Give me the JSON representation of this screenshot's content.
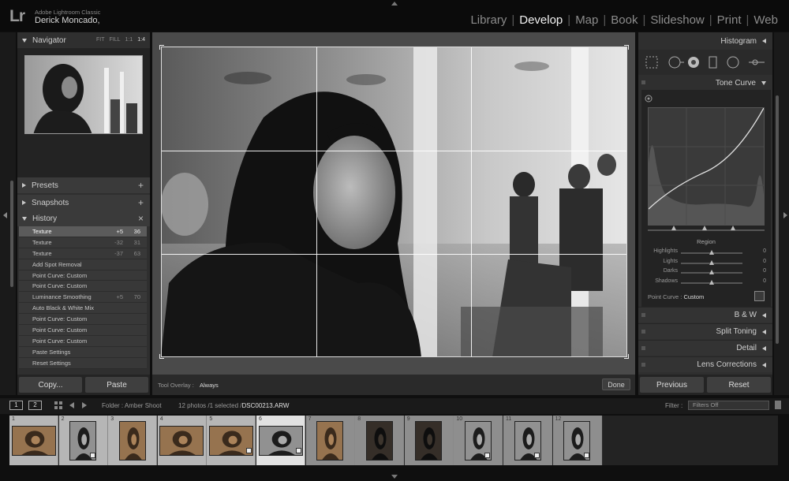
{
  "app": {
    "logo": "Lr",
    "app_name": "Adobe Lightroom Classic",
    "user_name": "Derick Moncado,"
  },
  "modules": [
    {
      "label": "Library",
      "active": false
    },
    {
      "label": "Develop",
      "active": true
    },
    {
      "label": "Map",
      "active": false
    },
    {
      "label": "Book",
      "active": false
    },
    {
      "label": "Slideshow",
      "active": false
    },
    {
      "label": "Print",
      "active": false
    },
    {
      "label": "Web",
      "active": false
    }
  ],
  "navigator": {
    "title": "Navigator",
    "zoom_fit": "FIT",
    "zoom_fill": "FILL",
    "zoom_1_1": "1:1",
    "zoom_1_4": "1:4"
  },
  "presets": {
    "title": "Presets"
  },
  "snapshots": {
    "title": "Snapshots"
  },
  "history": {
    "title": "History",
    "close": "×",
    "items": [
      {
        "label": "Texture",
        "v1": "+5",
        "v2": "36",
        "selected": true
      },
      {
        "label": "Texture",
        "v1": "-32",
        "v2": "31",
        "selected": false
      },
      {
        "label": "Texture",
        "v1": "-37",
        "v2": "63",
        "selected": false
      },
      {
        "label": "Add Spot Removal",
        "v1": "",
        "v2": "",
        "selected": false
      },
      {
        "label": "Point Curve: Custom",
        "v1": "",
        "v2": "",
        "selected": false
      },
      {
        "label": "Point Curve: Custom",
        "v1": "",
        "v2": "",
        "selected": false
      },
      {
        "label": "Luminance Smoothing",
        "v1": "+5",
        "v2": "70",
        "selected": false
      },
      {
        "label": "Auto Black & White Mix",
        "v1": "",
        "v2": "",
        "selected": false
      },
      {
        "label": "Point Curve: Custom",
        "v1": "",
        "v2": "",
        "selected": false
      },
      {
        "label": "Point Curve: Custom",
        "v1": "",
        "v2": "",
        "selected": false
      },
      {
        "label": "Point Curve: Custom",
        "v1": "",
        "v2": "",
        "selected": false
      },
      {
        "label": "Paste Settings",
        "v1": "",
        "v2": "",
        "selected": false
      },
      {
        "label": "Reset Settings",
        "v1": "",
        "v2": "",
        "selected": false
      }
    ]
  },
  "left_buttons": {
    "copy": "Copy...",
    "paste": "Paste"
  },
  "toolbar": {
    "overlay_label": "Tool Overlay :",
    "overlay_value": "Always",
    "done": "Done"
  },
  "right_panel": {
    "histogram": "Histogram",
    "tone_curve": "Tone Curve",
    "region": "Region",
    "sliders": [
      {
        "label": "Highlights",
        "value": "0"
      },
      {
        "label": "Lights",
        "value": "0"
      },
      {
        "label": "Darks",
        "value": "0"
      },
      {
        "label": "Shadows",
        "value": "0"
      }
    ],
    "point_curve_label": "Point Curve :",
    "point_curve_value": "Custom",
    "sections": [
      "B & W",
      "Split Toning",
      "Detail",
      "Lens Corrections"
    ],
    "previous": "Previous",
    "reset": "Reset"
  },
  "filmstrip_bar": {
    "screen1": "1",
    "screen2": "2",
    "folder": "Folder : Amber Shoot",
    "count": "12 photos /1 selected /",
    "filename": "DSC00213.ARW",
    "filter_label": "Filter :",
    "filter_value": "Filters Off"
  },
  "filmstrip": {
    "cells": [
      {
        "num": "1",
        "tone": "warm",
        "badge": false,
        "selected": false
      },
      {
        "num": "2",
        "tone": "bw",
        "badge": true,
        "selected": false
      },
      {
        "num": "3",
        "tone": "warm",
        "badge": false,
        "selected": false
      },
      {
        "num": "4",
        "tone": "warm",
        "badge": false,
        "selected": false
      },
      {
        "num": "5",
        "tone": "warm",
        "badge": true,
        "selected": false
      },
      {
        "num": "6",
        "tone": "bw",
        "badge": true,
        "selected": true
      },
      {
        "num": "7",
        "tone": "warm",
        "badge": false,
        "selected": false
      },
      {
        "num": "8",
        "tone": "dark",
        "badge": false,
        "selected": false
      },
      {
        "num": "9",
        "tone": "dark",
        "badge": false,
        "selected": false
      },
      {
        "num": "10",
        "tone": "bw",
        "badge": true,
        "selected": false
      },
      {
        "num": "11",
        "tone": "bw",
        "badge": true,
        "selected": false
      },
      {
        "num": "12",
        "tone": "bw",
        "badge": true,
        "selected": false
      }
    ]
  },
  "colors": {
    "panel": "#2f2f2f",
    "active_module": "#f2f2f2",
    "history_selected": "#5b5b5b",
    "filmstrip_selected": "#e2e2e2"
  }
}
